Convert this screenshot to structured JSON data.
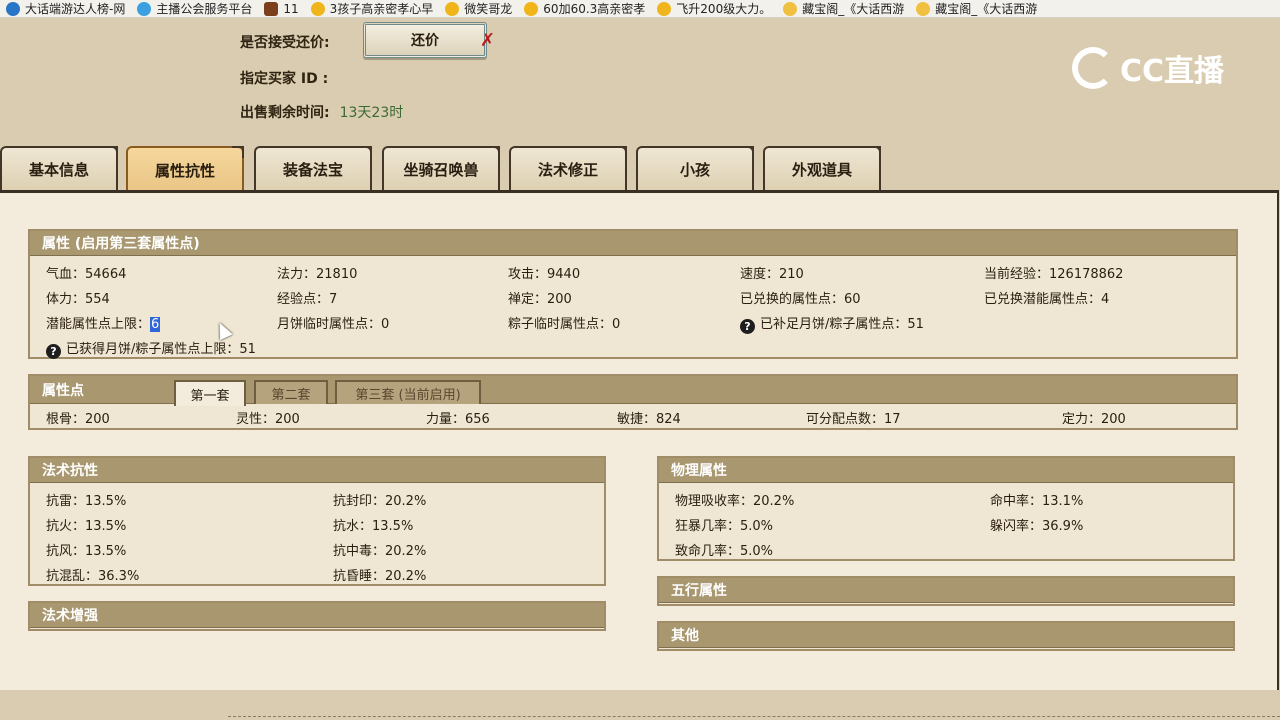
{
  "bookmarks": [
    {
      "label": "大话端游达人榜-网",
      "icon": "c-logo-icon"
    },
    {
      "label": "主播公会服务平台",
      "icon": "bilibili-icon"
    },
    {
      "label": "11",
      "icon": "game-icon"
    },
    {
      "label": "3孩子高亲密孝心早",
      "icon": "sparkle-icon"
    },
    {
      "label": "微笑哥龙",
      "icon": "sparkle-icon"
    },
    {
      "label": "60加60.3高亲密孝",
      "icon": "sparkle-icon"
    },
    {
      "label": "飞升200级大力。",
      "icon": "sparkle-icon"
    },
    {
      "label": "藏宝阁_《大话西游",
      "icon": "sparkle-icon"
    },
    {
      "label": "藏宝阁_《大话西游",
      "icon": "sparkle-icon"
    }
  ],
  "top": {
    "accept_counter_label": "是否接受还价:",
    "counter_button": "还价",
    "buyer_id_label": "指定买家 ID :",
    "remaining_label": "出售剩余时间:",
    "remaining_value": "13天23时"
  },
  "logo": {
    "text": "CC直播"
  },
  "tabs": [
    "基本信息",
    "属性抗性",
    "装备法宝",
    "坐骑召唤兽",
    "法术修正",
    "小孩",
    "外观道具"
  ],
  "attributes": {
    "title": "属性 (启用第三套属性点)",
    "rows": [
      [
        "气血：54664",
        "法力：21810",
        "攻击：9440",
        "速度：210",
        "当前经验：126178862"
      ],
      [
        "体力：554",
        "经验点：7",
        "禅定：200",
        "已兑换的属性点：60",
        "已兑换潜能属性点：4"
      ]
    ],
    "row3": {
      "potential_label": "潜能属性点上限：",
      "potential_value": "6",
      "mooncake_temp": "月饼临时属性点：0",
      "zongzi_temp": "粽子临时属性点：0",
      "filled": "已补足月饼/粽子属性点：51"
    },
    "row4": "已获得月饼/粽子属性点上限：51"
  },
  "attr_points": {
    "title": "属性点",
    "subtabs": [
      "第一套",
      "第二套",
      "第三套 (当前启用)"
    ],
    "values": [
      "根骨：200",
      "灵性：200",
      "力量：656",
      "敏捷：824",
      "可分配点数：17",
      "定力：200"
    ]
  },
  "magic_resist": {
    "title": "法术抗性",
    "left": [
      "抗雷：13.5%",
      "抗火：13.5%",
      "抗风：13.5%",
      "抗混乱：36.3%"
    ],
    "right": [
      "抗封印：20.2%",
      "抗水：13.5%",
      "抗中毒：20.2%",
      "抗昏睡：20.2%"
    ]
  },
  "magic_boost": {
    "title": "法术增强"
  },
  "physical": {
    "title": "物理属性",
    "left": [
      "物理吸收率：20.2%",
      "狂暴几率：5.0%",
      "致命几率：5.0%"
    ],
    "right": [
      "命中率：13.1%",
      "躲闪率：36.9%"
    ]
  },
  "five_elements": {
    "title": "五行属性"
  },
  "other": {
    "title": "其他"
  }
}
